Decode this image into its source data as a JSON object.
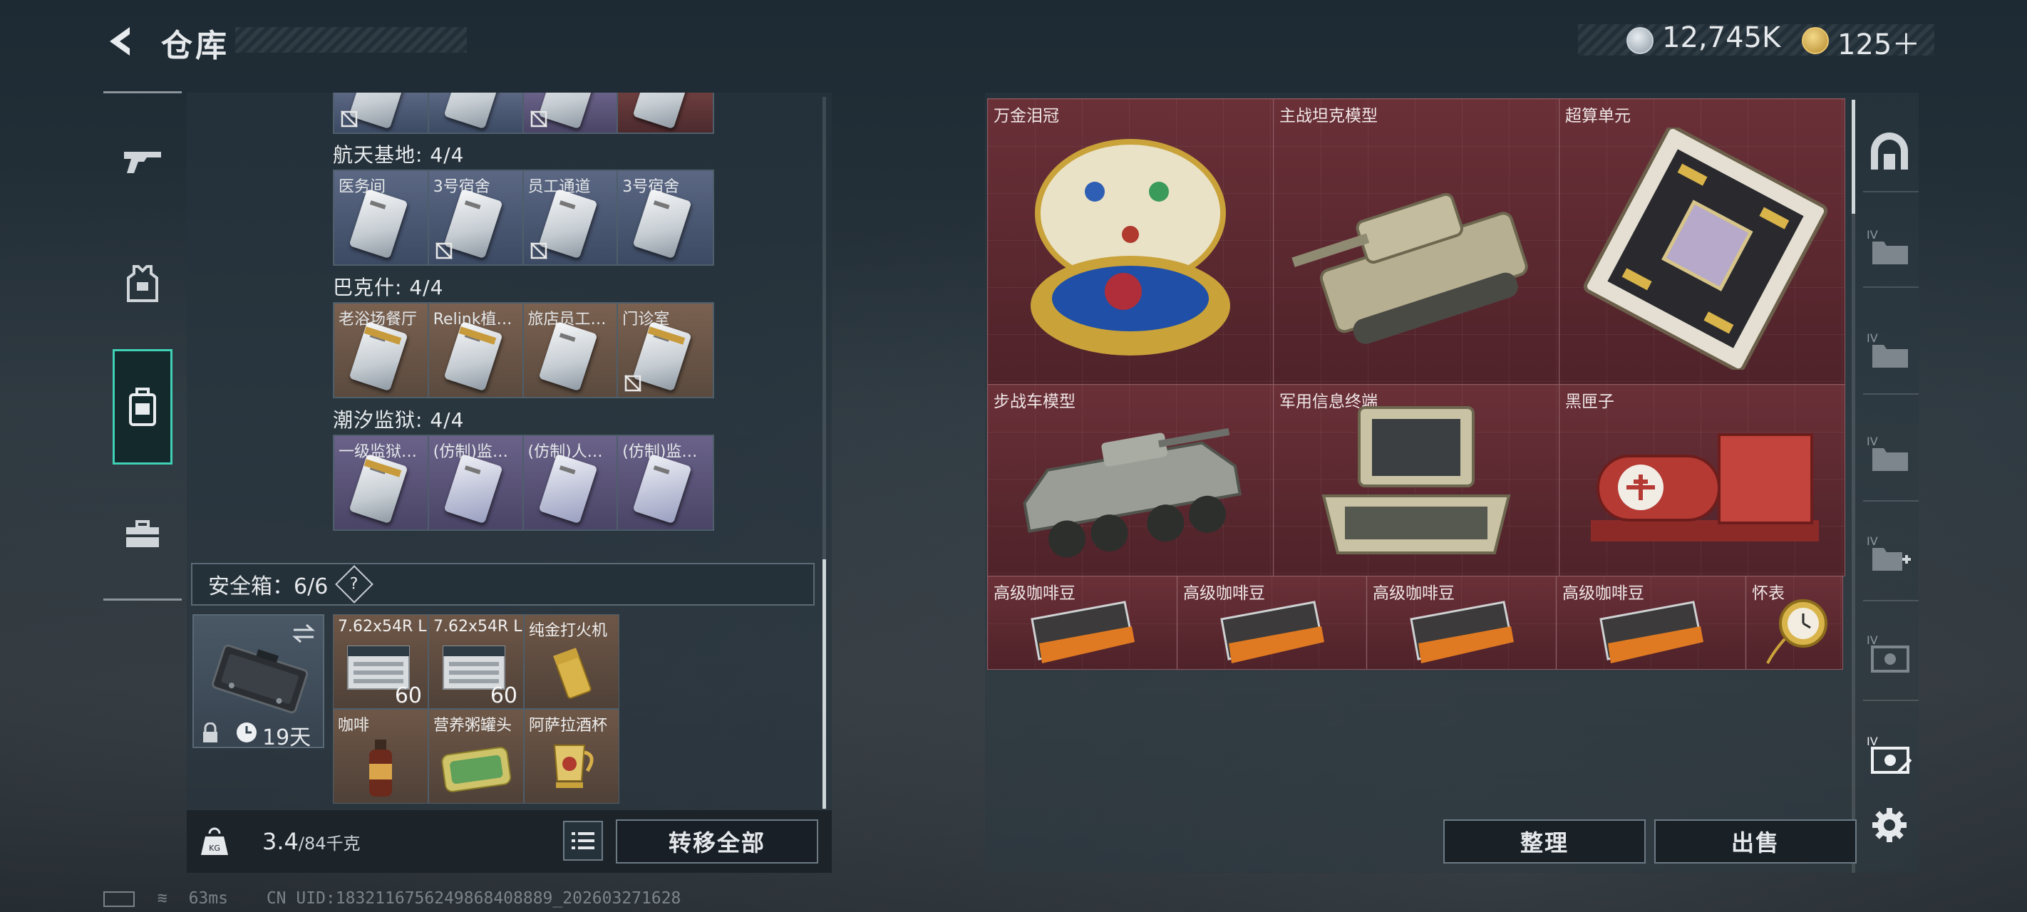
{
  "header": {
    "title": "仓库",
    "currency_main": "12,745K",
    "currency_secondary": "125＋"
  },
  "left_nav": {
    "items": [
      "weapon",
      "armor",
      "backpack",
      "toolbox"
    ],
    "active": "backpack"
  },
  "keycards": {
    "top_partial_row": [
      "",
      "",
      ""
    ],
    "groups": [
      {
        "title": "航天基地: 4/4",
        "items": [
          "医务间",
          "3号宿舍",
          "员工通道",
          "3号宿舍"
        ]
      },
      {
        "title": "巴克什: 4/4",
        "items": [
          "老浴场餐厅",
          "Relink植…",
          "旅店员工…",
          "门诊室"
        ]
      },
      {
        "title": "潮汐监狱: 4/4",
        "items": [
          "一级监狱…",
          "(仿制)监…",
          "(仿制)人…",
          "(仿制)监…"
        ]
      }
    ]
  },
  "safebox": {
    "title": "安全箱：6/6",
    "help": "?",
    "duration": "19天",
    "items": [
      {
        "name": "7.62x54R L…",
        "qty": "60"
      },
      {
        "name": "7.62x54R L…",
        "qty": "60"
      },
      {
        "name": "纯金打火机",
        "qty": ""
      },
      {
        "name": "咖啡",
        "qty": ""
      },
      {
        "name": "营养粥罐头",
        "qty": ""
      },
      {
        "name": "阿萨拉酒杯",
        "qty": ""
      }
    ]
  },
  "footer_left": {
    "weight_value": "3.4",
    "weight_capacity": "/84千克",
    "transfer_all": "转移全部"
  },
  "stash": {
    "large_items": [
      "万金泪冠",
      "主战坦克模型",
      "超算单元",
      "步战车模型",
      "军用信息终端",
      "黑匣子"
    ],
    "small_items": [
      "高级咖啡豆",
      "高级咖啡豆",
      "高级咖啡豆",
      "高级咖啡豆",
      "怀表"
    ]
  },
  "right_side": {
    "tiers": [
      "IV",
      "IV",
      "IV",
      "IV",
      "IV",
      "IV"
    ]
  },
  "actions": {
    "organize": "整理",
    "sell": "出售"
  },
  "status": {
    "ping": "63ms",
    "uid": "CN UID:1832116756249868408889_202603271628"
  },
  "colors": {
    "accent_teal": "#3fd0b6",
    "stash_slot": "#5e2a31",
    "gold_card": "#7a6150"
  }
}
